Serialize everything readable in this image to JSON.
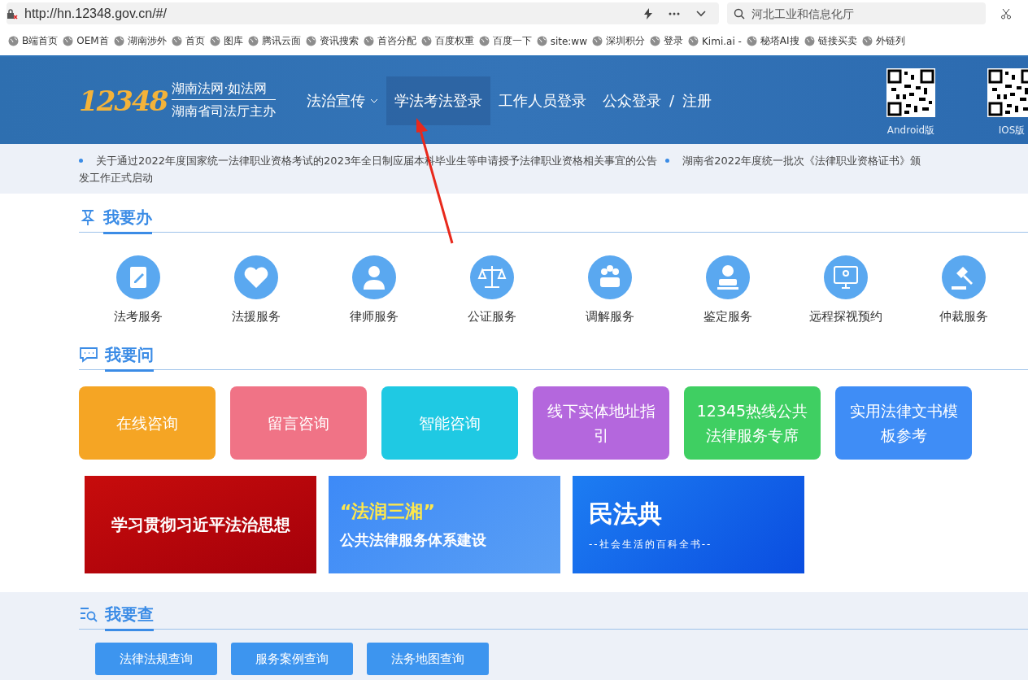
{
  "browser": {
    "url": "http://hn.12348.gov.cn/#/",
    "search_placeholder": "河北工业和信息化厅",
    "bookmarks": [
      "B端首页",
      "OEM首",
      "湖南涉外",
      "首页",
      "图库",
      "腾讯云面",
      "资讯搜索",
      "首咨分配",
      "百度权重",
      "百度一下",
      "site:ww",
      "深圳积分",
      "登录",
      "Kimi.ai -",
      "秘塔AI搜",
      "链接买卖",
      "外链列"
    ]
  },
  "header": {
    "logo_number": "12348",
    "logo_title": "湖南法网·如法网",
    "logo_subtitle": "湖南省司法厅主办",
    "nav": [
      {
        "label": "法治宣传",
        "dropdown": true,
        "selected": false
      },
      {
        "label": "学法考法登录",
        "dropdown": false,
        "selected": true
      },
      {
        "label": "工作人员登录",
        "dropdown": false,
        "selected": false
      }
    ],
    "public_login": "公众登录",
    "separator": "/",
    "register": "注册",
    "qr_codes": [
      "Android版",
      "IOS版"
    ]
  },
  "notices": [
    "关于通过2022年度国家统一法律职业资格考试的2023年全日制应届本科毕业生等申请授予法律职业资格相关事宜的公告",
    "湖南省2022年度统一批次《法律职业资格证书》颁发工作正式启动"
  ],
  "do_section": {
    "title": "我要办",
    "services": [
      {
        "label": "法考服务",
        "kind": "pen"
      },
      {
        "label": "法援服务",
        "kind": "heart"
      },
      {
        "label": "律师服务",
        "kind": "person"
      },
      {
        "label": "公证服务",
        "kind": "scale"
      },
      {
        "label": "调解服务",
        "kind": "group"
      },
      {
        "label": "鉴定服务",
        "kind": "stamp"
      },
      {
        "label": "远程探视预约",
        "kind": "screen"
      },
      {
        "label": "仲裁服务",
        "kind": "gavel"
      }
    ]
  },
  "ask_section": {
    "title": "我要问",
    "cards": [
      {
        "label": "在线咨询",
        "color": "#f5a524"
      },
      {
        "label": "留言咨询",
        "color": "#f07386"
      },
      {
        "label": "智能咨询",
        "color": "#1fc9e3"
      },
      {
        "label": "线下实体地址指引",
        "color": "#b467dd"
      },
      {
        "label": "12345热线公共法律服务专席",
        "color": "#3fcf62"
      },
      {
        "label": "实用法律文书模板参考",
        "color": "#3f8df6"
      }
    ],
    "banners": [
      {
        "title": "学习贯彻习近平法治思想",
        "kind": "red"
      },
      {
        "title": "“法润三湘”",
        "subtitle": "公共法律服务体系建设",
        "kind": "light"
      },
      {
        "title": "民法典",
        "subtitle": "--社会生活的百科全书--",
        "kind": "blue"
      }
    ]
  },
  "search_section": {
    "title": "我要查",
    "buttons": [
      "法律法规查询",
      "服务案例查询",
      "法务地图查询"
    ]
  }
}
